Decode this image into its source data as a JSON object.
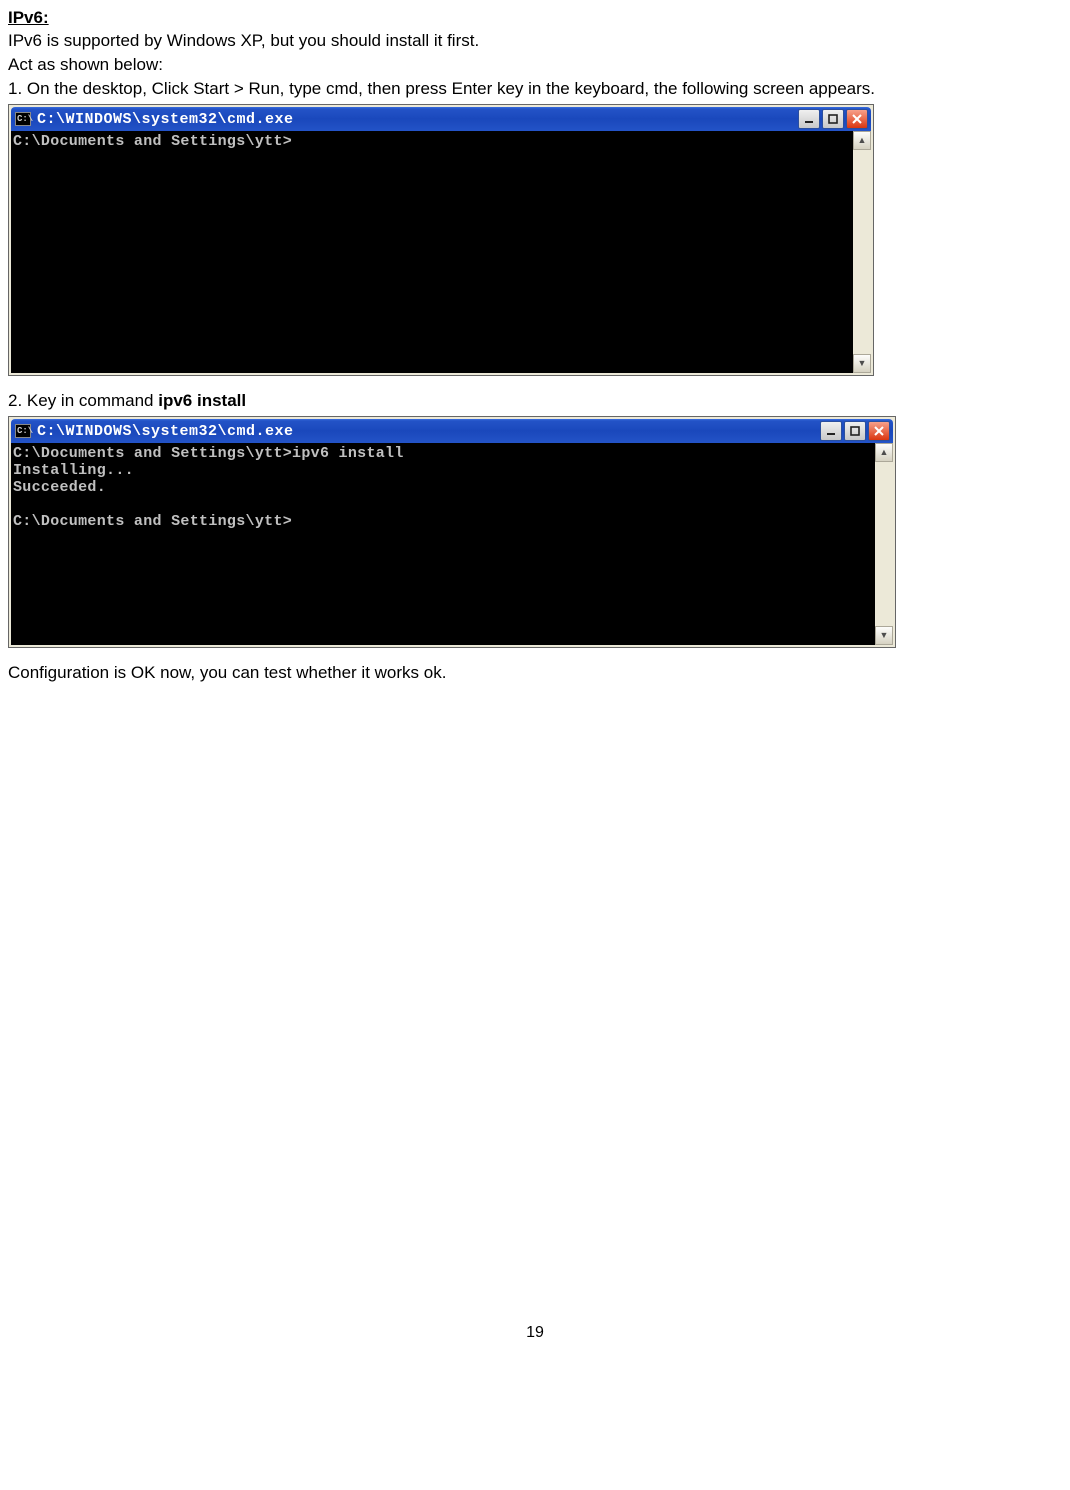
{
  "heading": "IPv6:",
  "paragraphs": {
    "p1": "IPv6 is supported by Windows XP, but you should install it first.",
    "p2": "Act as shown below:",
    "p3": "1. On the desktop, Click Start > Run, type cmd, then press Enter key in the keyboard, the following screen appears.",
    "p4_prefix": "2. Key in command ",
    "p4_bold": "ipv6 install",
    "p5": "Configuration is OK now, you can test whether it works ok."
  },
  "cmd_windows": {
    "title": "C:\\WINDOWS\\system32\\cmd.exe",
    "icon_text": "C:\\",
    "win1_body": "C:\\Documents and Settings\\ytt>",
    "win2_body": "C:\\Documents and Settings\\ytt>ipv6 install\nInstalling...\nSucceeded.\n\nC:\\Documents and Settings\\ytt>"
  },
  "page_number": "19"
}
